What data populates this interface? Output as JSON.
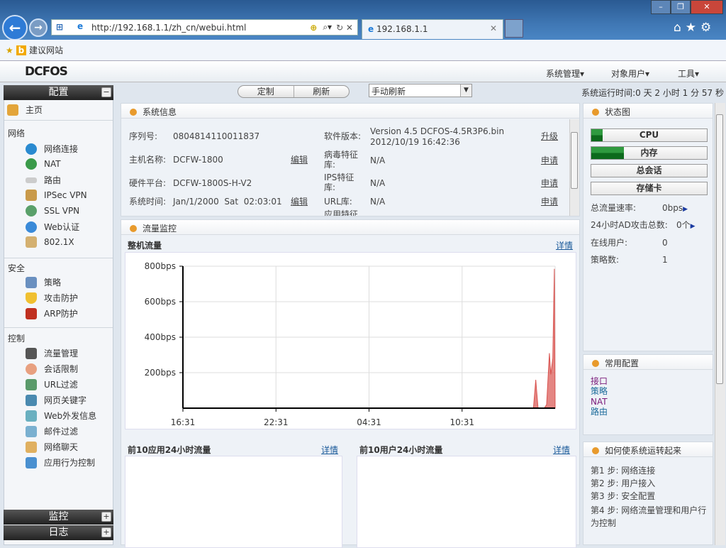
{
  "browser": {
    "url": "http://192.168.1.1/zh_cn/webui.html",
    "tab_title": "192.168.1.1",
    "favorites_label": "建议网站"
  },
  "app": {
    "logo": "DCFOS",
    "menus": [
      "系统管理",
      "对象用户",
      "工具"
    ]
  },
  "toolbar": {
    "customize": "定制",
    "refresh": "刷新",
    "refresh_mode": "手动刷新",
    "uptime": "系统运行时间:0 天 2 小时 1 分 57 秒"
  },
  "sidebar": {
    "title": "配置",
    "home": "主页",
    "groups": [
      {
        "label": "网络",
        "items": [
          "网络连接",
          "NAT",
          "路由",
          "IPSec VPN",
          "SSL VPN",
          "Web认证",
          "802.1X"
        ]
      },
      {
        "label": "安全",
        "items": [
          "策略",
          "攻击防护",
          "ARP防护"
        ]
      },
      {
        "label": "控制",
        "items": [
          "流量管理",
          "会话限制",
          "URL过滤",
          "网页关键字",
          "Web外发信息",
          "邮件过滤",
          "网络聊天",
          "应用行为控制"
        ]
      }
    ],
    "bottom": [
      "监控",
      "日志"
    ]
  },
  "sysinfo": {
    "title": "系统信息",
    "left": [
      {
        "label": "序列号:",
        "value": "0804814110011837",
        "action": ""
      },
      {
        "label": "主机名称:",
        "value": "DCFW-1800",
        "action": "编辑"
      },
      {
        "label": "硬件平台:",
        "value": "DCFW-1800S-H-V2",
        "action": ""
      },
      {
        "label": "系统时间:",
        "value": "Jan/1/2000  Sat  02:03:01",
        "action": "编辑"
      }
    ],
    "right": [
      {
        "label": "软件版本:",
        "value": "Version 4.5 DCFOS-4.5R3P6.bin",
        "value2": "2012/10/19 16:42:36",
        "action": "升级"
      },
      {
        "label": "病毒特征库:",
        "value": "N/A",
        "action": "申请"
      },
      {
        "label": "IPS特征库:",
        "value": "N/A",
        "action": "申请"
      },
      {
        "label": "URL库:",
        "value": "N/A",
        "action": "申请"
      },
      {
        "label": "应用特征",
        "value": "",
        "action": ""
      }
    ]
  },
  "traffic": {
    "title": "流量监控",
    "subtitle": "整机流量",
    "details": "详情"
  },
  "chart_data": {
    "type": "area",
    "title": "整机流量",
    "ylabel": "bps",
    "xlabel": "",
    "ylim": [
      0,
      800
    ],
    "yticks": [
      200,
      400,
      600,
      800
    ],
    "ytick_labels": [
      "200bps",
      "400bps",
      "600bps",
      "800bps"
    ],
    "xlim_hours": [
      0,
      24
    ],
    "xticks_hours": [
      0,
      6,
      12,
      18
    ],
    "xtick_labels": [
      "16:31",
      "22:31",
      "04:31",
      "10:31"
    ],
    "grid": true,
    "color": "#d9534f",
    "points": [
      [
        0,
        0
      ],
      [
        22.6,
        0
      ],
      [
        22.75,
        160
      ],
      [
        22.9,
        0
      ],
      [
        23.3,
        0
      ],
      [
        23.45,
        20
      ],
      [
        23.63,
        310
      ],
      [
        23.72,
        190
      ],
      [
        23.85,
        280
      ],
      [
        23.95,
        785
      ],
      [
        24,
        0
      ]
    ]
  },
  "top_apps": {
    "title": "前10应用24小时流量",
    "details": "详情"
  },
  "top_users": {
    "title": "前10用户24小时流量",
    "details": "详情"
  },
  "status": {
    "title": "状态图",
    "bars": [
      {
        "label": "CPU",
        "percent": 10
      },
      {
        "label": "内存",
        "percent": 28
      },
      {
        "label": "总会话",
        "percent": 0
      },
      {
        "label": "存储卡",
        "percent": 0
      }
    ],
    "stats": [
      {
        "label": "总流量速率:",
        "value": "0bps"
      },
      {
        "label": "24小时AD攻击总数:",
        "value": "0个"
      },
      {
        "label": "在线用户:",
        "value": "0"
      },
      {
        "label": "策略数:",
        "value": "1"
      }
    ]
  },
  "common": {
    "title": "常用配置",
    "links": [
      "接口",
      "策略",
      "NAT",
      "路由"
    ]
  },
  "howto": {
    "title": "如何使系统运转起来",
    "steps": [
      "第1 步: 网络连接",
      "第2 步: 用户接入",
      "第3 步: 安全配置",
      "第4 步: 网络流量管理和用户行为控制"
    ]
  }
}
